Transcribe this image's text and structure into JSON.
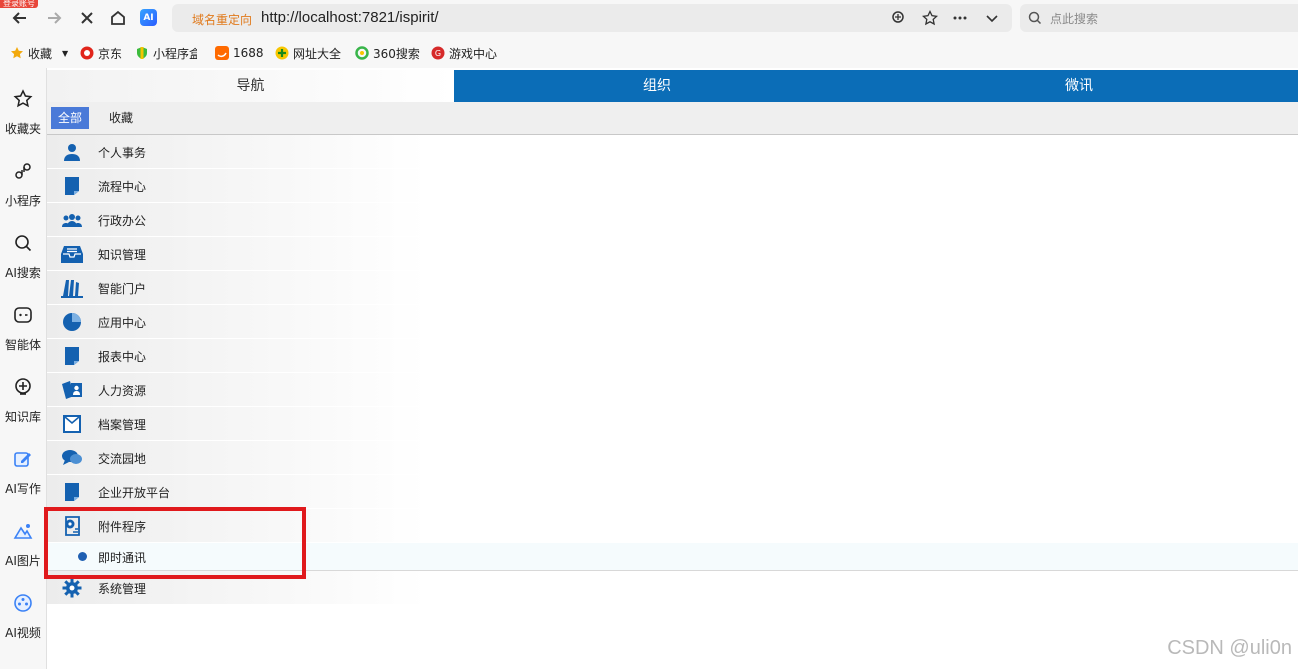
{
  "browser": {
    "login_badge": "登录账号",
    "ai_badge": "AI",
    "redirect_label": "域名重定向",
    "url": "http://localhost:7821/ispirit/",
    "search_placeholder": "点此搜索"
  },
  "bookmarks": {
    "favorites": "收藏",
    "items": [
      "京东",
      "小程序盒",
      "1688",
      "网址大全",
      "360搜索",
      "游戏中心"
    ]
  },
  "sidebar": {
    "items": [
      {
        "label": "收藏夹",
        "icon": "star-icon"
      },
      {
        "label": "小程序",
        "icon": "mini-program-icon"
      },
      {
        "label": "AI搜索",
        "icon": "search-icon"
      },
      {
        "label": "智能体",
        "icon": "agent-icon"
      },
      {
        "label": "知识库",
        "icon": "knowledge-icon"
      },
      {
        "label": "AI写作",
        "icon": "write-icon"
      },
      {
        "label": "AI图片",
        "icon": "image-icon"
      },
      {
        "label": "AI视频",
        "icon": "video-icon"
      }
    ]
  },
  "app": {
    "tabs": [
      {
        "label": "导航",
        "active": true
      },
      {
        "label": "组织",
        "active": false
      },
      {
        "label": "微讯",
        "active": false
      }
    ],
    "filters": [
      {
        "label": "全部",
        "active": true
      },
      {
        "label": "收藏",
        "active": false
      }
    ],
    "menu": [
      {
        "label": "个人事务",
        "icon": "person-icon"
      },
      {
        "label": "流程中心",
        "icon": "document-icon"
      },
      {
        "label": "行政办公",
        "icon": "group-icon"
      },
      {
        "label": "知识管理",
        "icon": "inbox-icon"
      },
      {
        "label": "智能门户",
        "icon": "books-icon"
      },
      {
        "label": "应用中心",
        "icon": "pie-chart-icon"
      },
      {
        "label": "报表中心",
        "icon": "report-icon"
      },
      {
        "label": "人力资源",
        "icon": "people-card-icon"
      },
      {
        "label": "档案管理",
        "icon": "archive-icon"
      },
      {
        "label": "交流园地",
        "icon": "chat-icon"
      },
      {
        "label": "企业开放平台",
        "icon": "platform-icon"
      },
      {
        "label": "附件程序",
        "icon": "gear-document-icon"
      }
    ],
    "submenu": {
      "label": "即时通讯"
    },
    "menu_after": {
      "label": "系统管理",
      "icon": "gear-icon"
    },
    "accent_color": "#0b6db7",
    "highlight_color": "#e0191c"
  },
  "watermark": "CSDN @uli0n"
}
